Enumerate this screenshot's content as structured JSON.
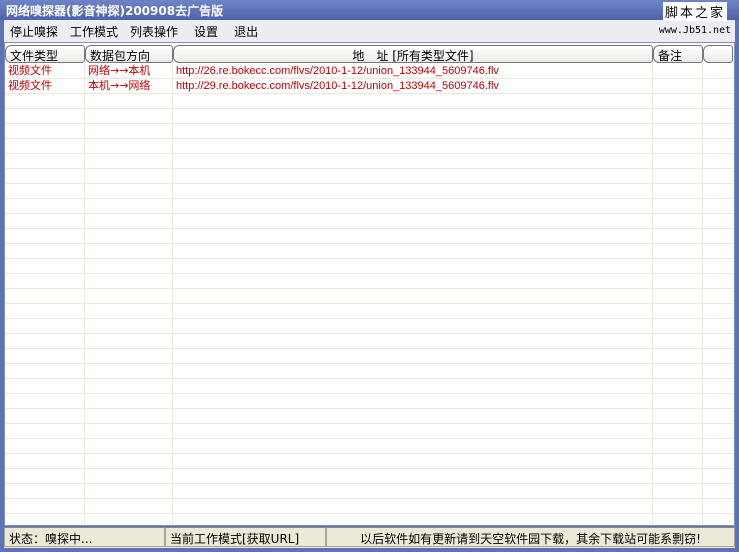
{
  "title": "网络嗅探器(影音神探)200908去广告版",
  "watermark": {
    "line1": "脚本之家",
    "line2": "www.Jb51.net"
  },
  "menu": [
    "停止嗅探",
    "工作模式",
    "列表操作",
    "设置",
    "退出"
  ],
  "columns": [
    "文件类型",
    "数据包方向",
    "地　址 [所有类型文件]",
    "备注",
    ""
  ],
  "rows": [
    {
      "type": "视频文件",
      "direction": "网络→→本机",
      "url": "http://26.re.bokecc.com/flvs/2010-1-12/union_133944_5609746.flv",
      "note": ""
    },
    {
      "type": "视频文件",
      "direction": "本机→→网络",
      "url": "http://29.re.bokecc.com/flvs/2010-1-12/union_133944_5609746.flv",
      "note": ""
    }
  ],
  "status": {
    "state": "状态：嗅探中...",
    "mode": "当前工作模式[获取URL]",
    "notice": "以后软件如有更新请到天空软件园下载，其余下载站可能系剽窃!"
  }
}
